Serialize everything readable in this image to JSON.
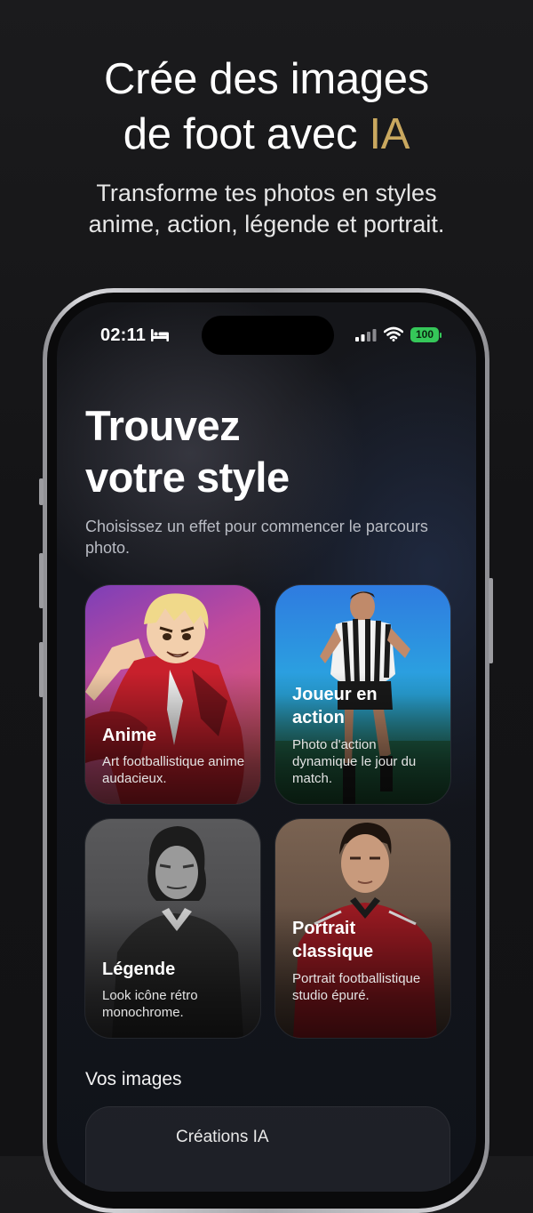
{
  "promo": {
    "title_line1": "Crée des images",
    "title_line2_prefix": "de foot avec ",
    "title_line2_accent": "IA",
    "subtitle_line1": "Transforme tes photos en styles",
    "subtitle_line2": "anime, action, légende et portrait.",
    "accent_color": "#c9a85f"
  },
  "status_bar": {
    "time": "02:11",
    "sleep_icon": "bed-icon",
    "signal_icon": "cellular-signal-icon",
    "wifi_icon": "wifi-icon",
    "battery": "100"
  },
  "screen": {
    "title_line1": "Trouvez",
    "title_line2": "votre style",
    "subtitle": "Choisissez un effet pour commencer le parcours photo."
  },
  "styles": [
    {
      "title": "Anime",
      "description": "Art footballistique anime audacieux."
    },
    {
      "title": "Joueur en action",
      "description": "Photo d'action dynamique le jour du match."
    },
    {
      "title": "Légende",
      "description": "Look icône rétro monochrome."
    },
    {
      "title": "Portrait classique",
      "description": "Portrait footballistique studio épuré."
    }
  ],
  "images_section": {
    "title": "Vos images",
    "panel_label": "Créations IA"
  }
}
